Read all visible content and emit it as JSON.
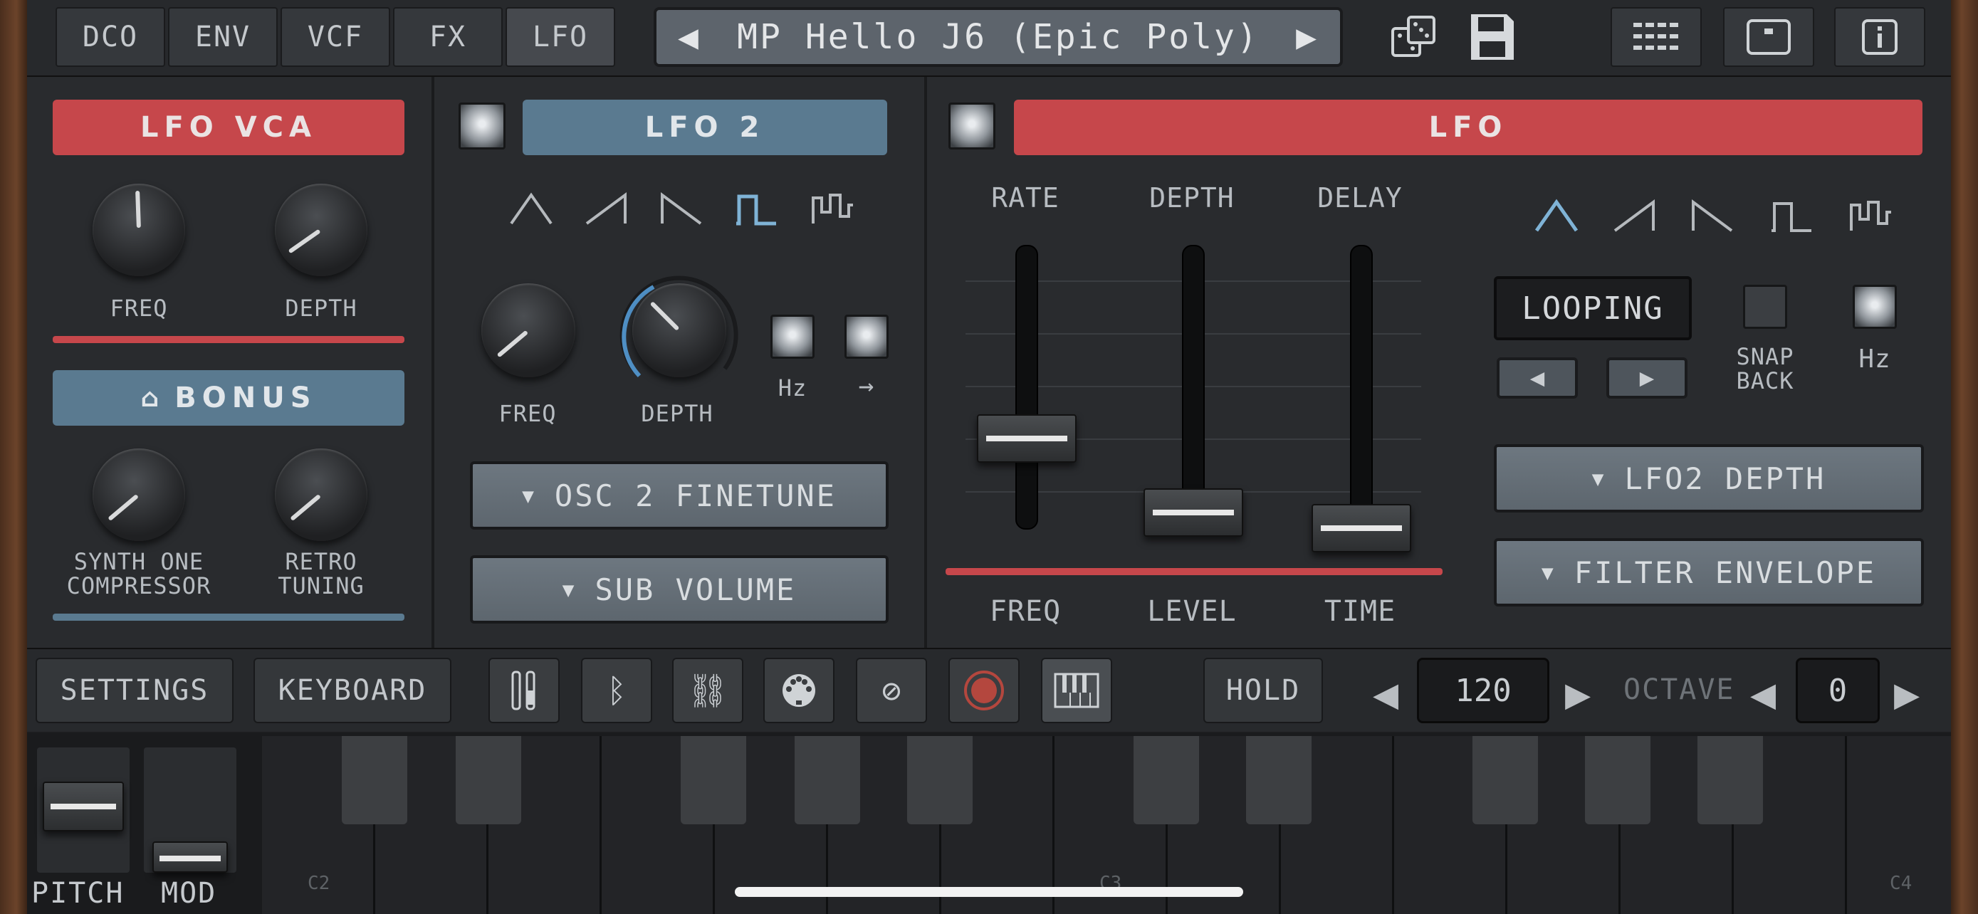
{
  "tabs": [
    "DCO",
    "ENV",
    "VCF",
    "FX",
    "LFO"
  ],
  "active_tab": "LFO",
  "preset": {
    "name": "MP Hello J6 (Epic Poly)",
    "prev": "◀",
    "next": "▶"
  },
  "lfo_vca": {
    "title": "LFO VCA",
    "knob_labels": [
      "FREQ",
      "DEPTH"
    ],
    "bonus_title": "BONUS",
    "bonus_labels": [
      "SYNTH ONE\nCOMPRESSOR",
      "RETRO\nTUNING"
    ]
  },
  "lfo2": {
    "title": "LFO 2",
    "knob_labels": [
      "FREQ",
      "DEPTH"
    ],
    "hz_label": "Hz",
    "arrow_label": "→",
    "dropdowns": [
      "OSC 2 FINETUNE",
      "SUB VOLUME"
    ],
    "selected_wave": "square"
  },
  "lfo": {
    "title": "LFO",
    "fader_top_labels": [
      "RATE",
      "DEPTH",
      "DELAY"
    ],
    "fader_bottom_labels": [
      "FREQ",
      "LEVEL",
      "TIME"
    ],
    "mode": "LOOPING",
    "snap_back": "SNAP\nBACK",
    "hz_label": "Hz",
    "dropdowns": [
      "LFO2 DEPTH",
      "FILTER ENVELOPE"
    ],
    "selected_wave": "triangle"
  },
  "bottom": {
    "settings": "SETTINGS",
    "keyboard": "KEYBOARD",
    "hold": "HOLD",
    "tempo": "120",
    "octave_label": "OCTAVE",
    "octave": "0",
    "pitch": "PITCH",
    "mod": "MOD"
  },
  "keyboard_labels": [
    "C2",
    "C3",
    "C4"
  ]
}
